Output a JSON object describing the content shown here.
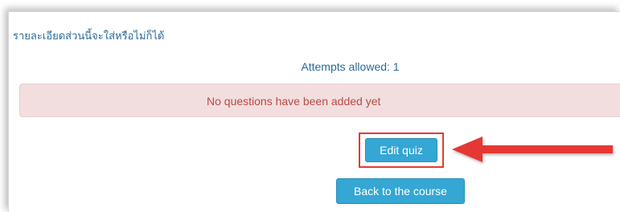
{
  "intro_text": "รายละเอียดส่วนนี้จะใส่หรือไม่ก็ได้",
  "attempts_text": "Attempts allowed: 1",
  "alert": {
    "message": "No questions have been added yet"
  },
  "buttons": {
    "edit_quiz": "Edit quiz",
    "back_to_course": "Back to the course"
  },
  "colors": {
    "accent_blue": "#34a7d4",
    "link_text": "#2a6a9a",
    "alert_bg": "#f2dede",
    "alert_text": "#b94a48",
    "annotation_red": "#e53935"
  },
  "annotation": {
    "icon": "red-arrow-icon"
  }
}
